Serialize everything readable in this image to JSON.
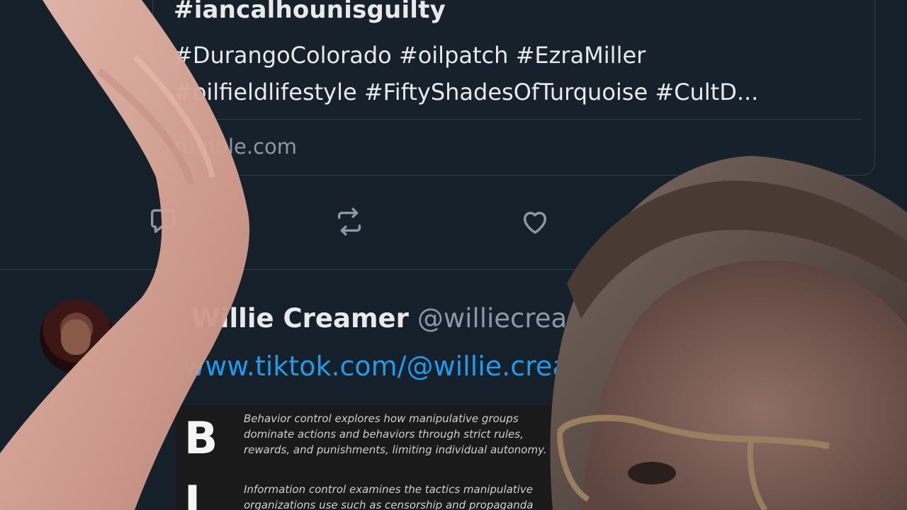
{
  "card": {
    "headline": "#iancalhounisguilty",
    "description_lines": [
      "#DurangoColorado #oilpatch #EzraMiller",
      "#oilfieldlifestyle #FiftyShadesOfTurquoise #CultD..."
    ],
    "domain": "rumble.com"
  },
  "actions": {
    "reply_icon": "reply-icon",
    "retweet_icon": "retweet-icon",
    "like_icon": "heart-icon"
  },
  "tweet": {
    "name": "Willie Creamer",
    "handle": "@williecreamer",
    "link": "www.tiktok.com/@willie.creamer"
  },
  "embed": {
    "letter1": "B",
    "para1": "Behavior control explores how manipulative groups dominate actions and behaviors through strict rules, rewards, and punishments, limiting individual autonomy.",
    "letter2": "I",
    "para2": "Information control examines the tactics manipulative organizations use such as censorship and propaganda"
  },
  "colors": {
    "background": "#15202b",
    "text": "#e7e9ea",
    "muted": "#8b98a5",
    "link": "#1d9bf0",
    "border": "#2f3b47"
  }
}
